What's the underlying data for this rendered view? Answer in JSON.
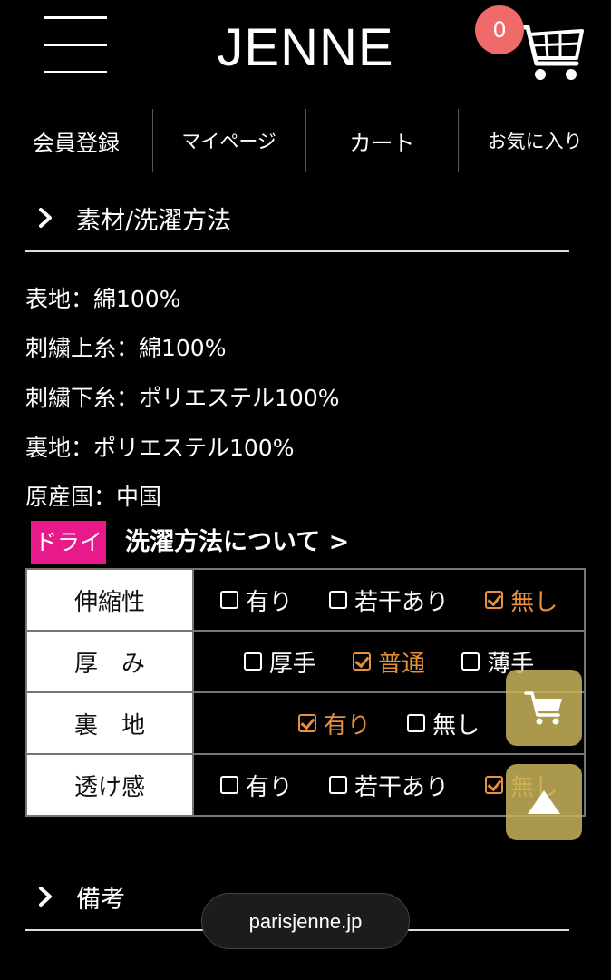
{
  "header": {
    "logo": "JENNE",
    "cart_count": "0"
  },
  "nav": {
    "items": [
      {
        "label": "会員登録"
      },
      {
        "label": "マイページ"
      },
      {
        "label": "カート"
      },
      {
        "label": "お気に入り"
      }
    ]
  },
  "material_section": {
    "title": "素材/洗濯方法",
    "lines": [
      "表地：綿100%",
      "刺繍上糸：綿100%",
      "刺繍下糸：ポリエステル100%",
      "裏地：ポリエステル100%",
      "原産国：中国"
    ]
  },
  "wash": {
    "badge": "ドライ",
    "link": "洗濯方法について >"
  },
  "spec_table": {
    "rows": [
      {
        "label": "伸縮性",
        "options": [
          {
            "text": "有り",
            "checked": false
          },
          {
            "text": "若干あり",
            "checked": false
          },
          {
            "text": "無し",
            "checked": true
          }
        ]
      },
      {
        "label": "厚　み",
        "options": [
          {
            "text": "厚手",
            "checked": false
          },
          {
            "text": "普通",
            "checked": true
          },
          {
            "text": "薄手",
            "checked": false
          }
        ]
      },
      {
        "label": "裏　地",
        "options": [
          {
            "text": "有り",
            "checked": true
          },
          {
            "text": "無し",
            "checked": false
          }
        ]
      },
      {
        "label": "透け感",
        "options": [
          {
            "text": "有り",
            "checked": false
          },
          {
            "text": "若干あり",
            "checked": false
          },
          {
            "text": "無し",
            "checked": true
          }
        ]
      }
    ]
  },
  "notes_section": {
    "title": "備考"
  },
  "browser": {
    "url": "parisjenne.jp"
  },
  "colors": {
    "accent_checked": "#e8913a",
    "badge_pink": "#e8198b",
    "cart_badge": "#f06a6a",
    "float_button": "#c8b45a"
  }
}
